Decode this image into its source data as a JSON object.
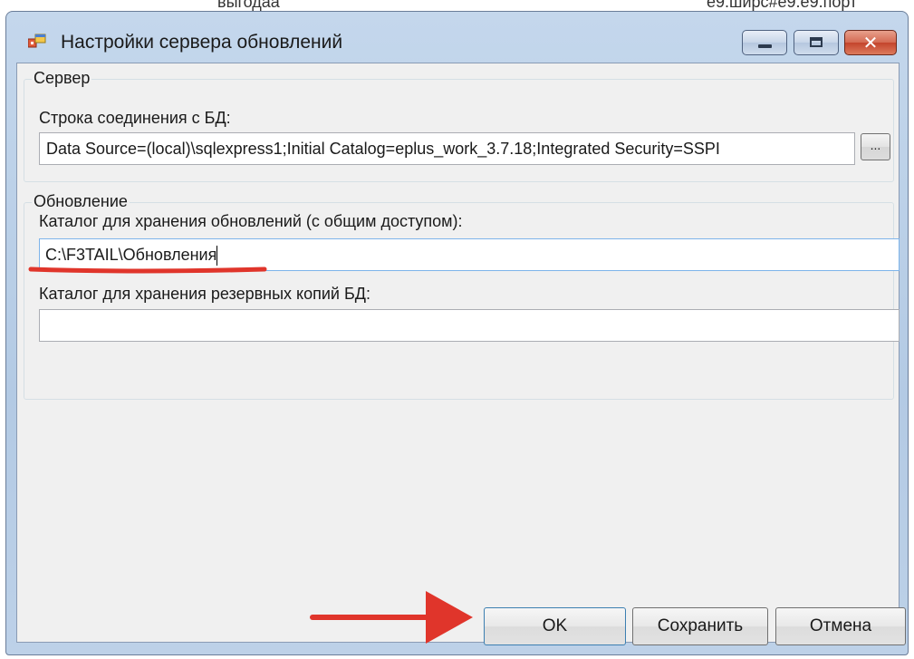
{
  "background": {
    "left_fragment": "выгодаа",
    "right_fragment": "e9.ширс#e9.e9.порт"
  },
  "window": {
    "title": "Настройки сервера обновлений",
    "close_glyph": "✕"
  },
  "server_group": {
    "legend": "Сервер",
    "connection_label": "Строка соединения с БД:",
    "connection_value": "Data Source=(local)\\sqlexpress1;Initial Catalog=eplus_work_3.7.18;Integrated Security=SSPI",
    "browse_label": "..."
  },
  "update_group": {
    "legend": "Обновление",
    "updates_dir_label": "Каталог для хранения обновлений (с общим доступом):",
    "updates_dir_value": "C:\\F3TAIL\\Обновления",
    "backup_dir_label": "Каталог для хранения резервных копий БД:",
    "backup_dir_value": ""
  },
  "buttons": {
    "ok": "OK",
    "save": "Сохранить",
    "cancel": "Отмена"
  },
  "colors": {
    "annotation_red": "#e0352b",
    "focus_border": "#7eb4ea"
  }
}
